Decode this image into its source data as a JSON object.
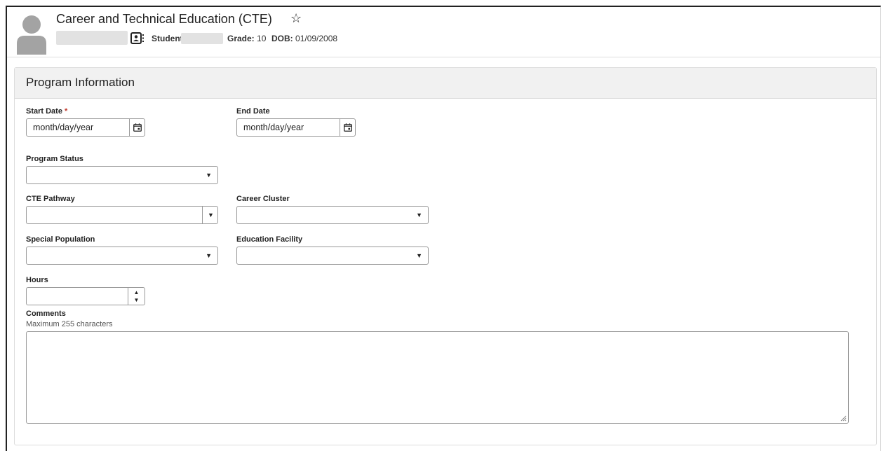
{
  "header": {
    "title": "Career and Technical Education (CTE)",
    "student_label": "Student #:",
    "grade_label": "Grade:",
    "grade_value": "10",
    "dob_label": "DOB:",
    "dob_value": "01/09/2008"
  },
  "icons": [
    "person-avatar-icon",
    "star-outline-icon",
    "contact-card-icon",
    "calendar-icon",
    "chevron-down-icon",
    "spinner-arrows-icon",
    "resize-grip-icon"
  ],
  "panel": {
    "title": "Program Information",
    "start_date": {
      "label": "Start Date",
      "required_mark": "*",
      "placeholder": "month/day/year"
    },
    "end_date": {
      "label": "End Date",
      "placeholder": "month/day/year"
    },
    "program_status": {
      "label": "Program Status",
      "value": ""
    },
    "cte_pathway": {
      "label": "CTE Pathway",
      "value": ""
    },
    "career_cluster": {
      "label": "Career Cluster",
      "value": ""
    },
    "special_population": {
      "label": "Special Population",
      "value": ""
    },
    "education_facility": {
      "label": "Education Facility",
      "value": ""
    },
    "hours": {
      "label": "Hours",
      "value": ""
    },
    "comments": {
      "label": "Comments",
      "hint": "Maximum 255 characters",
      "value": ""
    }
  },
  "colors": {
    "required": "#c0392b",
    "panel_header_bg": "#f1f1f1",
    "avatar": "#a3a3a3"
  }
}
